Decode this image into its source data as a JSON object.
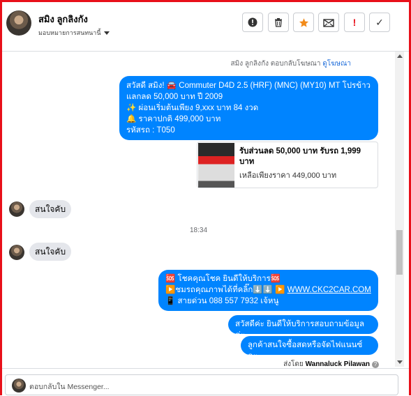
{
  "header": {
    "name": "สมิง ลูกลิงกัง",
    "assign_label": "มอบหมายการสนทนานี้",
    "buttons": [
      {
        "icon": "alert-circle-icon",
        "glyph": "❗"
      },
      {
        "icon": "trash-icon",
        "glyph": "🗑"
      },
      {
        "icon": "star-icon",
        "glyph": "★"
      },
      {
        "icon": "mail-icon",
        "glyph": "✉"
      },
      {
        "icon": "exclamation-icon",
        "glyph": "!"
      },
      {
        "icon": "check-icon",
        "glyph": "✓"
      }
    ]
  },
  "conversation": {
    "system_note_prefix": "สมิง ลูกลิงกัง ตอบกลับโฆษณา",
    "system_note_link": "ดูโฆษณา",
    "ad_bubble": {
      "line1": "สวัสดี สมิง! 🚘 Commuter D4D 2.5 (HRF) (MNC) (MY10) MT โปรข้าว",
      "line2": "แลกลด 50,000 บาท ปี 2009",
      "line3": "✨  ผ่อนเริ่มต้นเพียง 9,xxx บาท  84 งวด",
      "line4": "🔔  ราคาปกติ 499,000 บาท",
      "line5": "รหัสรถ : T050"
    },
    "card": {
      "title": "รับส่วนลด 50,000 บาท รับรถ 1,999 บาท",
      "subtitle": "เหลือเพียงราคา 449,000 บาท"
    },
    "incoming1": "สนใจคับ",
    "time": "18:34",
    "incoming2": "สนใจคับ",
    "reply_bubble": {
      "line1": "🆘 โชคคุณโชค ยินดีให้บริการ🆘",
      "line2": "▶️ชมรถคุณภาพได้ที่คลิ๊ก⬇️⬇️     ▶️ ",
      "link": "WWW.CKC2CAR.COM",
      "line3": "📱 สายด่วน 088 557 7932 เจ้หนู"
    },
    "reply2": "สวัสดีค่ะ  ยินดีให้บริการสอบถามข้อมูลค่ะ",
    "reply3": "ลูกค้าสนใจซื้อสดหรือจัดไฟแนนซ์คะ",
    "sent_by_prefix": "ส่งโดย",
    "sent_by_name": "Wannaluck Pilawan"
  },
  "composer": {
    "placeholder": "ตอบกลับใน Messenger..."
  },
  "colors": {
    "accent": "#0084ff",
    "frame": "#e8101a",
    "incoming": "#e4e6eb"
  }
}
